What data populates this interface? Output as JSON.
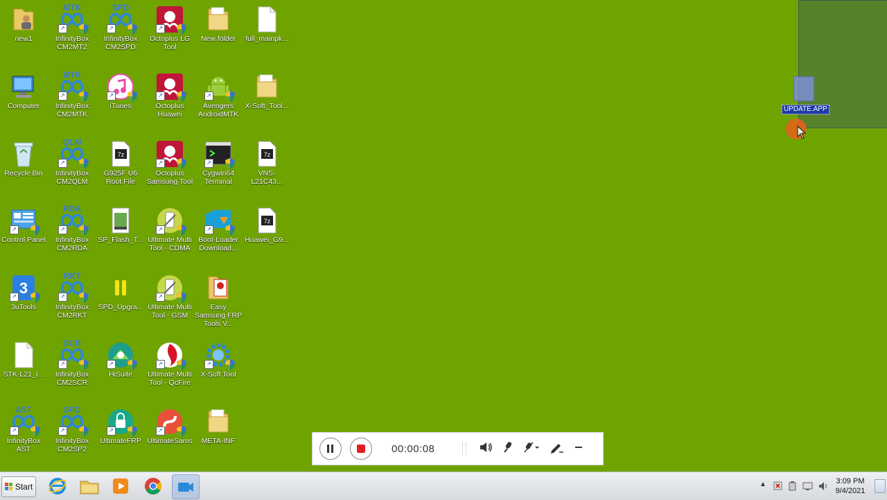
{
  "desktop": {
    "icons": [
      {
        "label": "new1"
      },
      {
        "label": "InfinityBox CM2MT2",
        "badge": "MTK"
      },
      {
        "label": "InfinityBox CM2SPD",
        "badge": "SPD"
      },
      {
        "label": "Octoplus LG Tool"
      },
      {
        "label": "New folder"
      },
      {
        "label": "full_mainpk..."
      },
      {
        "label": "Computer"
      },
      {
        "label": "InfinityBox CM2MTK",
        "badge": "MTK"
      },
      {
        "label": "iTunes"
      },
      {
        "label": "Octoplus Huawei"
      },
      {
        "label": "Avengers AndroidMTK"
      },
      {
        "label": "X-Soft_Tool..."
      },
      {
        "label": "Recycle Bin"
      },
      {
        "label": "InfinityBox CM2QLM",
        "badge": "QLM"
      },
      {
        "label": "G925F U6 Root File"
      },
      {
        "label": "Octoplus Samsung Tool"
      },
      {
        "label": "Cygwin64 Terminal"
      },
      {
        "label": "VNS-L21C43..."
      },
      {
        "label": "Control Panel"
      },
      {
        "label": "InfinityBox CM2RDA",
        "badge": "RDA"
      },
      {
        "label": "SP_Flash_T..."
      },
      {
        "label": "Ultimate Multi Tool - CDMA"
      },
      {
        "label": "Boot-Loader Download..."
      },
      {
        "label": "Huawei_G9..."
      },
      {
        "label": "3uTools"
      },
      {
        "label": "InfinityBox CM2RKT",
        "badge": "RKT"
      },
      {
        "label": "SPD_Upgra..."
      },
      {
        "label": "Ultimate Multi Tool - GSM"
      },
      {
        "label": "Easy Samsung FRP Tools V..."
      },
      {
        "label": "STK-L21_I..."
      },
      {
        "label": "InfinityBox CM2SCR",
        "badge": "SCR"
      },
      {
        "label": "HiSuite"
      },
      {
        "label": "Ultimate Multi Tool - QcFire"
      },
      {
        "label": "X-Soft Tool"
      },
      {
        "label": "InfinityBox AST",
        "badge": "AST"
      },
      {
        "label": "InfinityBox CM2SP2",
        "badge": "SPD"
      },
      {
        "label": "UltimateFRP"
      },
      {
        "label": "UltimateSams"
      },
      {
        "label": "META-INF"
      }
    ],
    "dragging_file_label": "UPDATE.APP"
  },
  "recorder": {
    "timer": "00:00:08",
    "pause_icon": "pause-icon",
    "stop_icon": "stop-icon"
  },
  "taskbar": {
    "start_label": "Start",
    "clock_time": "3:09 PM",
    "clock_date": "9/4/2021"
  },
  "colors": {
    "desktop_bg": "#6fa400",
    "stop_red": "#e02020",
    "selection": "#4a6a56"
  }
}
